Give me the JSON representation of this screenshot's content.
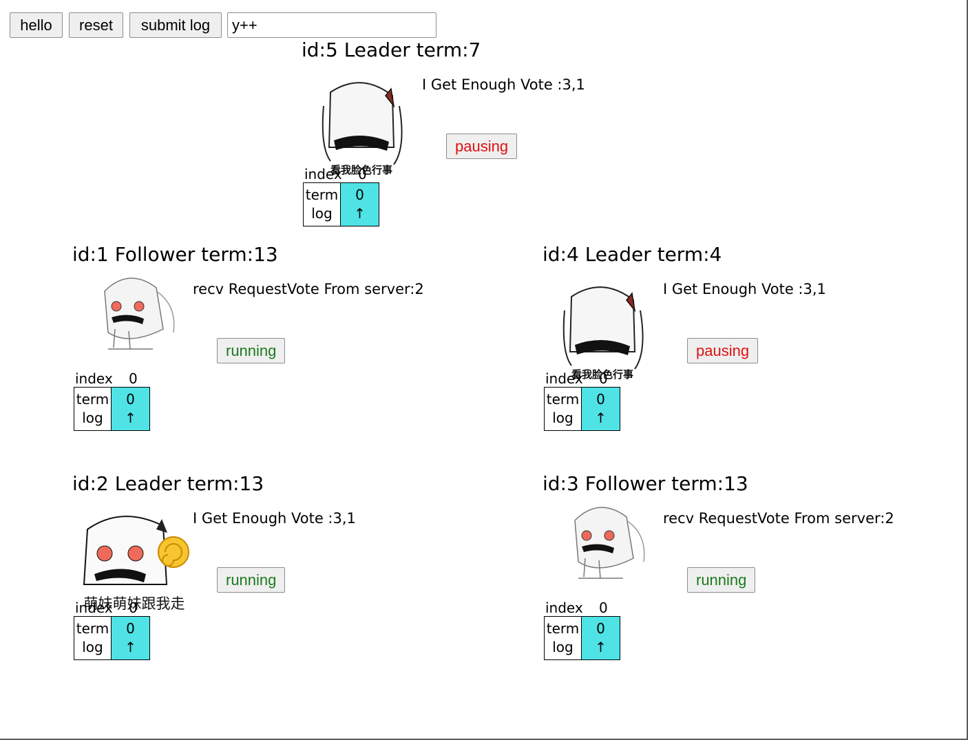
{
  "toolbar": {
    "hello_label": "hello",
    "reset_label": "reset",
    "submit_label": "submit log",
    "input_value": "y++"
  },
  "colors": {
    "log_cell": "#4fe3e6",
    "running": "#1a7a1a",
    "pausing": "#e01010"
  },
  "nodes": [
    {
      "title": "id:5 Leader term:7",
      "message": "I Get Enough Vote :3,1",
      "state": "pausing",
      "avatar": "chibi-girl-sticker-icon",
      "caption": "看我脸色行事",
      "log_index_label": "index",
      "log_index_value": "0",
      "log_term_label": "term",
      "log_log_label": "log",
      "log_term_value": "0",
      "log_arrow": "↑"
    },
    {
      "title": "id:1 Follower term:13",
      "message": "recv RequestVote From server:2",
      "state": "running",
      "avatar": "chibi-girl-crouching-icon",
      "caption": "",
      "log_index_label": "index",
      "log_index_value": "0",
      "log_term_label": "term",
      "log_log_label": "log",
      "log_term_value": "0",
      "log_arrow": "↑"
    },
    {
      "title": "id:4 Leader term:4",
      "message": "I Get Enough Vote :3,1",
      "state": "pausing",
      "avatar": "chibi-girl-sticker-icon",
      "caption": "看我脸色行事",
      "log_index_label": "index",
      "log_index_value": "0",
      "log_term_label": "term",
      "log_log_label": "log",
      "log_term_value": "0",
      "log_arrow": "↑"
    },
    {
      "title": "id:2 Leader term:13",
      "message": "I Get Enough Vote :3,1",
      "state": "running",
      "avatar": "chibi-girl-lollipop-icon",
      "caption": "萌妹萌妹跟我走",
      "log_index_label": "index",
      "log_index_value": "0",
      "log_term_label": "term",
      "log_log_label": "log",
      "log_term_value": "0",
      "log_arrow": "↑"
    },
    {
      "title": "id:3 Follower term:13",
      "message": "recv RequestVote From server:2",
      "state": "running",
      "avatar": "chibi-girl-crouching-icon",
      "caption": "",
      "log_index_label": "index",
      "log_index_value": "0",
      "log_term_label": "term",
      "log_log_label": "log",
      "log_term_value": "0",
      "log_arrow": "↑"
    }
  ]
}
